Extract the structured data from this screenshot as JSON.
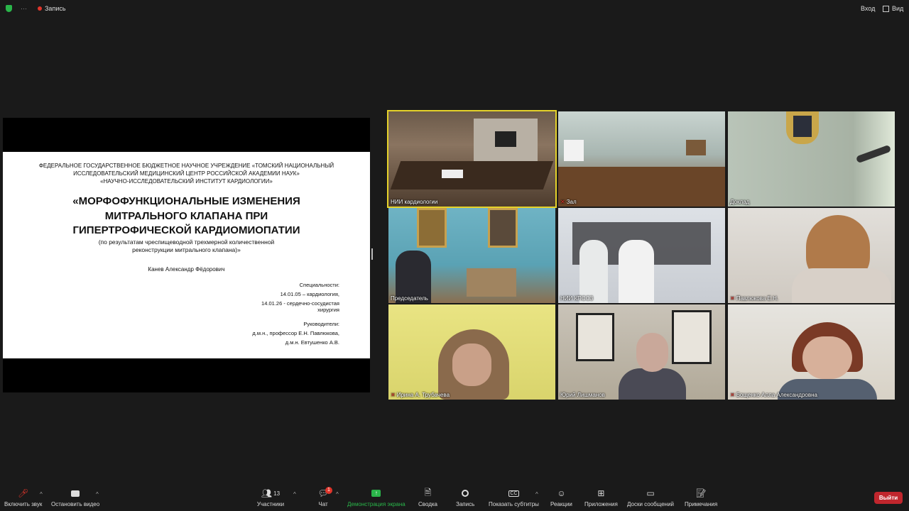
{
  "topbar": {
    "record_label": "Запись",
    "signin": "Вход",
    "view": "Вид"
  },
  "slide": {
    "org": [
      "ФЕДЕРАЛЬНОЕ ГОСУДАРСТВЕННОЕ БЮДЖЕТНОЕ НАУЧНОЕ УЧРЕЖДЕНИЕ «ТОМСКИЙ НАЦИОНАЛЬНЫЙ",
      "ИССЛЕДОВАТЕЛЬСКИЙ МЕДИЦИНСКИЙ ЦЕНТР РОССИЙСКОЙ АКАДЕМИИ НАУК»",
      "«НАУЧНО-ИССЛЕДОВАТЕЛЬСКИЙ ИНСТИТУТ КАРДИОЛОГИИ»"
    ],
    "title": [
      "«МОРФОФУНКЦИОНАЛЬНЫЕ ИЗМЕНЕНИЯ",
      "МИТРАЛЬНОГО КЛАПАНА ПРИ",
      "ГИПЕРТРОФИЧЕСКОЙ КАРДИОМИОПАТИИ"
    ],
    "subtitle": [
      "(по результатам чреспищеводной трехмерной количественной",
      "реконструкции митрального клапана)»"
    ],
    "author": "Канев Александр Фёдорович",
    "specialty_header": "Специальности:",
    "specialty_1": "14.01.05 – кардиология,",
    "specialty_2": "14.01.26 - сердечно-сосудистая",
    "specialty_3": "хирургия",
    "advisors_header": "Руководители:",
    "advisor_1": "д.м.н., профессор Е.Н. Павлюкова,",
    "advisor_2": "д.м.н. Евтушенко А.В."
  },
  "participants": [
    {
      "name": "НИИ кардиологии",
      "muted": false
    },
    {
      "name": "Зал",
      "muted": true
    },
    {
      "name": "Доклад",
      "muted": false
    },
    {
      "name": "Председатель",
      "muted": false
    },
    {
      "name": "НИИ КПССЗ",
      "muted": false
    },
    {
      "name": "Павлюкова Е.Н.",
      "muted": true
    },
    {
      "name": "Ирина А. Трубачева",
      "muted": true
    },
    {
      "name": "Юрий Лишманов",
      "muted": false
    },
    {
      "name": "Бощенко Алла Александровна",
      "muted": true
    }
  ],
  "toolbar": {
    "unmute": "Включить звук",
    "stop_video": "Остановить видео",
    "participants": "Участники",
    "participants_count": "13",
    "chat": "Чат",
    "chat_badge": "1",
    "share_screen": "Демонстрация экрана",
    "summary": "Сводка",
    "record": "Запись",
    "captions": "Показать субтитры",
    "reactions": "Реакции",
    "apps": "Приложения",
    "whiteboards": "Доски сообщений",
    "notes": "Примечания",
    "leave": "Выйти"
  },
  "colors": {
    "accent_green": "#2ab54a",
    "leave_red": "#c0262d",
    "active_speaker": "#e5d22a"
  }
}
